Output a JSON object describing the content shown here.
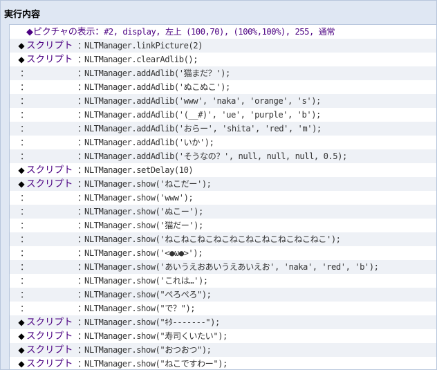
{
  "panel": {
    "title": "実行内容"
  },
  "picture_command": {
    "label": "◆ピクチャの表示：",
    "params": "#2, display, 左上 (100,70), (100%,100%), 255, 通常"
  },
  "script_label": "スクリプト",
  "separator": "：",
  "continuation_mark": "：",
  "rows": [
    {
      "kind": "script",
      "code": "NLTManager.linkPicture(2)"
    },
    {
      "kind": "script",
      "code": "NLTManager.clearAdlib();"
    },
    {
      "kind": "cont",
      "code": "NLTManager.addAdlib('猫まだ？');"
    },
    {
      "kind": "cont",
      "code": "NLTManager.addAdlib('ぬこぬこ');"
    },
    {
      "kind": "cont",
      "code": "NLTManager.addAdlib('www', 'naka', 'orange', 's');"
    },
    {
      "kind": "cont",
      "code": "NLTManager.addAdlib('(__#)', 'ue', 'purple', 'b');"
    },
    {
      "kind": "cont",
      "code": "NLTManager.addAdlib('おらー', 'shita', 'red', 'm');"
    },
    {
      "kind": "cont",
      "code": "NLTManager.addAdlib('いか');"
    },
    {
      "kind": "cont",
      "code": "NLTManager.addAdlib('そうなの？', null, null, null, 0.5);"
    },
    {
      "kind": "script",
      "code": "NLTManager.setDelay(10)"
    },
    {
      "kind": "script",
      "code": "NLTManager.show('ねこだー');"
    },
    {
      "kind": "cont",
      "code": "NLTManager.show('www');"
    },
    {
      "kind": "cont",
      "code": "NLTManager.show('ぬこー');"
    },
    {
      "kind": "cont",
      "code": "NLTManager.show('猫だー');"
    },
    {
      "kind": "cont",
      "code": "NLTManager.show('ねこねこねこねこねこねこねこねこねこねこ');"
    },
    {
      "kind": "cont",
      "code": "NLTManager.show('<●ω●>');"
    },
    {
      "kind": "cont",
      "code": "NLTManager.show('あいうえおあいうえあいえお', 'naka', 'red', 'b');"
    },
    {
      "kind": "cont",
      "code": "NLTManager.show('これは…');"
    },
    {
      "kind": "cont",
      "code": "NLTManager.show(\"ぺろぺろ\");"
    },
    {
      "kind": "cont",
      "code": "NLTManager.show(\"で？\");"
    },
    {
      "kind": "script",
      "code": "NLTManager.show(\"ｷﾀ-------\");"
    },
    {
      "kind": "script",
      "code": "NLTManager.show(\"寿司くいたい\");"
    },
    {
      "kind": "script",
      "code": "NLTManager.show(\"おつおつ\");"
    },
    {
      "kind": "script",
      "code": "NLTManager.show(\"ねこですわー\");"
    }
  ],
  "colors": {
    "command_label": "#4b0082",
    "code_text": "#333333",
    "panel_bg": "#dfe7f3",
    "row_alt_bg": "#eef1f6"
  }
}
